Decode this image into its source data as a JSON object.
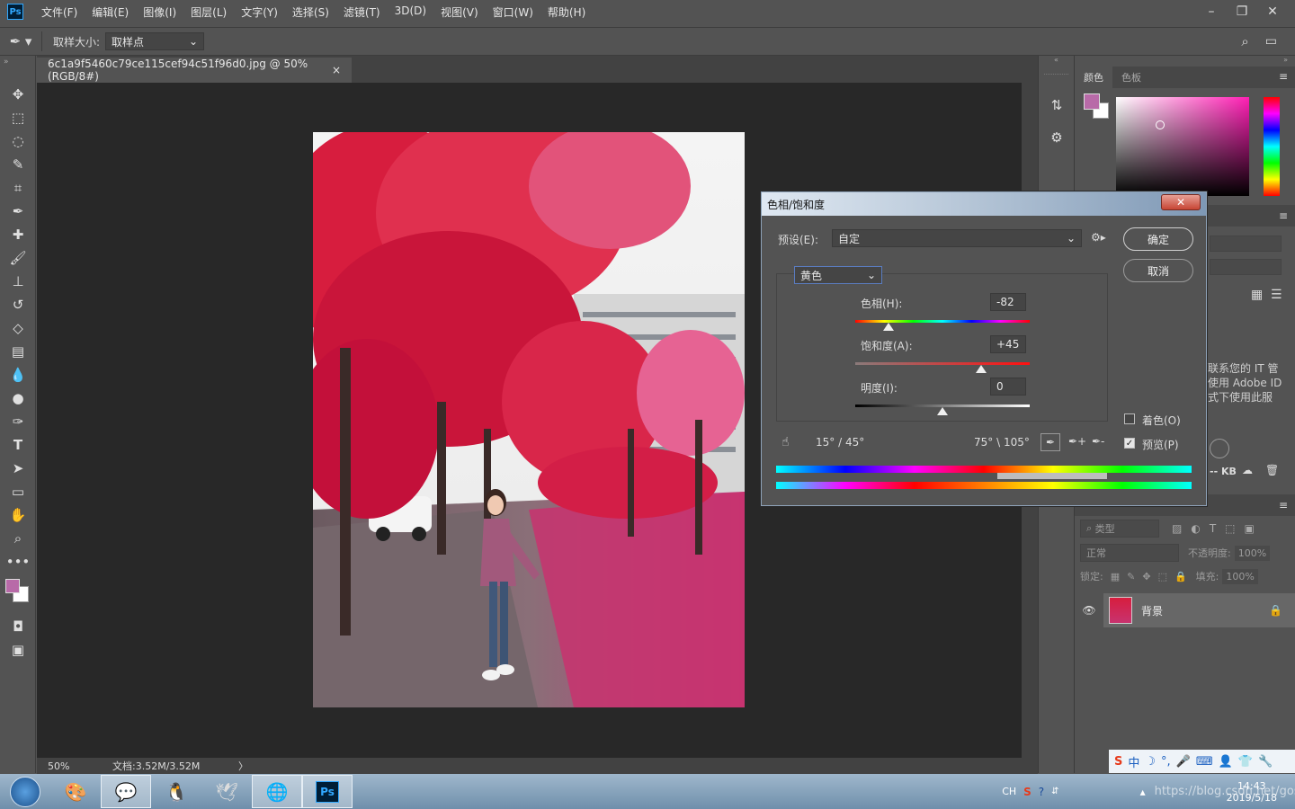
{
  "app": {
    "logo": "Ps"
  },
  "menu": [
    "文件(F)",
    "编辑(E)",
    "图像(I)",
    "图层(L)",
    "文字(Y)",
    "选择(S)",
    "滤镜(T)",
    "3D(D)",
    "视图(V)",
    "窗口(W)",
    "帮助(H)"
  ],
  "options": {
    "sample_size_label": "取样大小:",
    "sample_size_value": "取样点"
  },
  "document": {
    "tab_title": "6c1a9f5460c79ce115cef94c51f96d0.jpg @ 50%(RGB/8#)",
    "tab_close": "×"
  },
  "status": {
    "zoom": "50%",
    "doc_info": "文档:3.52M/3.52M",
    "arrow": "〉"
  },
  "color_panel": {
    "tab_color": "颜色",
    "tab_swatches": "色板",
    "foreground": "#b86aa8",
    "background": "#ffffff"
  },
  "libraries": {
    "message_lines": [
      "联系您的 IT 管",
      "使用 Adobe ID",
      "式下使用此服"
    ],
    "size_label": "-- KB"
  },
  "layers": {
    "search_placeholder": "类型",
    "blend_mode": "正常",
    "opacity_label": "不透明度:",
    "opacity_value": "100%",
    "lock_label": "锁定:",
    "fill_label": "填充:",
    "fill_value": "100%",
    "layer_name": "背景"
  },
  "dialog": {
    "title": "色相/饱和度",
    "close": "✕",
    "preset_label": "预设(E):",
    "preset_value": "自定",
    "ok": "确定",
    "cancel": "取消",
    "channel": "黄色",
    "hue_label": "色相(H):",
    "hue_value": "-82",
    "sat_label": "饱和度(A):",
    "sat_value": "+45",
    "light_label": "明度(I):",
    "light_value": "0",
    "colorize_label": "着色(O)",
    "preview_label": "预览(P)",
    "range_left": "15° / 45°",
    "range_right": "75° \\ 105°"
  },
  "taskbar": {
    "lang": "CH",
    "time": "14:43",
    "date": "2019/5/18",
    "watermark": "https://blog.csdn.net/goszam",
    "ime_label": "中"
  }
}
